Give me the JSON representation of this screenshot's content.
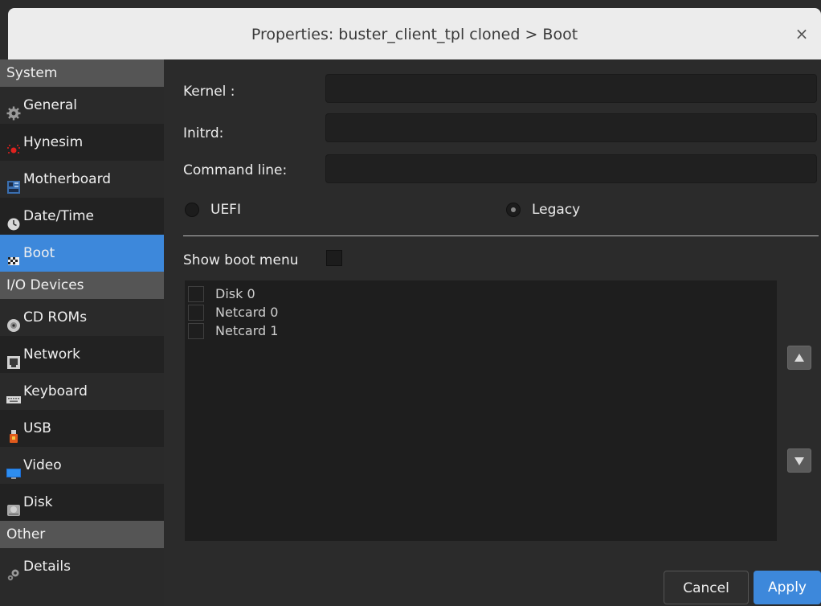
{
  "window": {
    "title": "Properties: buster_client_tpl cloned > Boot",
    "close": "×"
  },
  "sidebar": {
    "sections": [
      {
        "label": "System"
      },
      {
        "label": "I/O Devices"
      },
      {
        "label": "Other"
      }
    ],
    "items": [
      {
        "label": "General",
        "icon": "gear-icon"
      },
      {
        "label": "Hynesim",
        "icon": "hynesim-icon"
      },
      {
        "label": "Motherboard",
        "icon": "motherboard-icon"
      },
      {
        "label": "Date/Time",
        "icon": "clock-icon"
      },
      {
        "label": "Boot",
        "icon": "boot-flag-icon"
      },
      {
        "label": "CD ROMs",
        "icon": "cdrom-icon"
      },
      {
        "label": "Network",
        "icon": "network-icon"
      },
      {
        "label": "Keyboard",
        "icon": "keyboard-icon"
      },
      {
        "label": "USB",
        "icon": "usb-icon"
      },
      {
        "label": "Video",
        "icon": "monitor-icon"
      },
      {
        "label": "Disk",
        "icon": "disk-icon"
      },
      {
        "label": "Details",
        "icon": "gears-icon"
      }
    ]
  },
  "form": {
    "kernel_label": "Kernel :",
    "kernel_value": "",
    "initrd_label": "Initrd:",
    "initrd_value": "",
    "cmdline_label": "Command line:",
    "cmdline_value": "",
    "uefi_label": "UEFI",
    "legacy_label": "Legacy",
    "selected_mode": "Legacy",
    "show_boot_menu_label": "Show boot menu",
    "show_boot_menu_checked": false
  },
  "boot_order": [
    {
      "label": "Disk 0",
      "checked": false
    },
    {
      "label": "Netcard 0",
      "checked": false
    },
    {
      "label": "Netcard 1",
      "checked": false
    }
  ],
  "buttons": {
    "cancel": "Cancel",
    "apply": "Apply"
  },
  "colors": {
    "accent": "#3d88db",
    "panel": "#2b2b2b",
    "section": "#555555"
  }
}
